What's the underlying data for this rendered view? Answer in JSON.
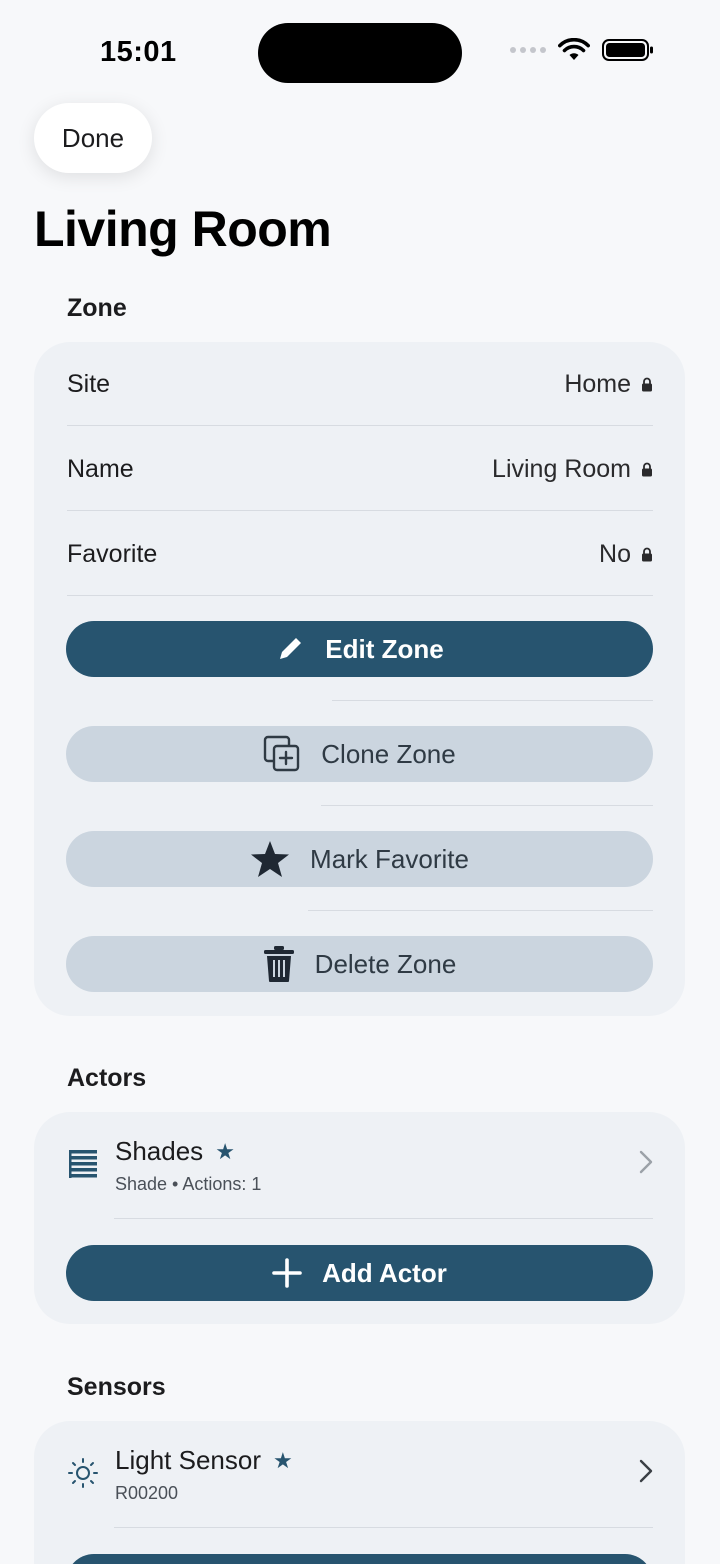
{
  "status_bar": {
    "time": "15:01"
  },
  "nav": {
    "done_label": "Done"
  },
  "page": {
    "title": "Living Room"
  },
  "zone": {
    "header": "Zone",
    "rows": [
      {
        "label": "Site",
        "value": "Home"
      },
      {
        "label": "Name",
        "value": "Living Room"
      },
      {
        "label": "Favorite",
        "value": "No"
      }
    ],
    "buttons": {
      "edit": "Edit Zone",
      "clone": "Clone Zone",
      "favorite": "Mark Favorite",
      "delete": "Delete Zone"
    }
  },
  "actors": {
    "header": "Actors",
    "items": [
      {
        "name": "Shades",
        "subtitle": "Shade • Actions: 1",
        "icon": "shade-icon",
        "favorite": true
      }
    ],
    "add_label": "Add Actor"
  },
  "sensors": {
    "header": "Sensors",
    "items": [
      {
        "name": "Light Sensor",
        "subtitle": "R00200",
        "icon": "sun-icon",
        "favorite": true
      }
    ]
  },
  "colors": {
    "primary": "#27546f",
    "secondary_button": "#cbd5df",
    "card": "#eef1f5",
    "background": "#f7f8fa"
  }
}
